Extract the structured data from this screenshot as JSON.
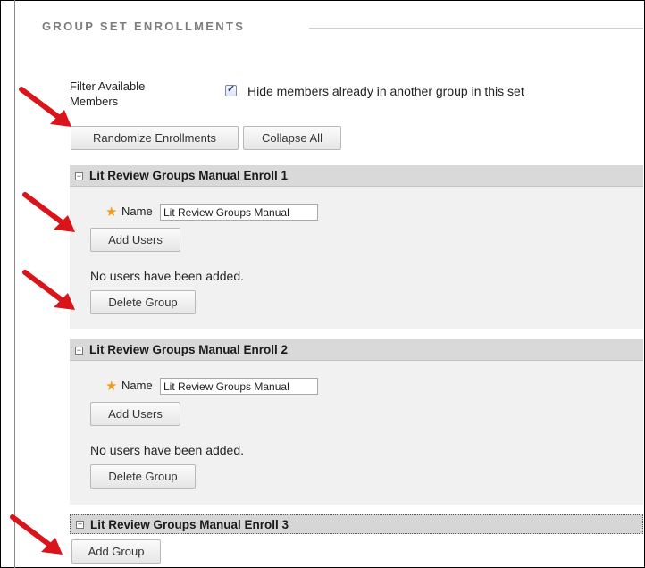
{
  "section_heading": "GROUP SET ENROLLMENTS",
  "filter": {
    "label": "Filter Available Members",
    "checkbox_checked": true,
    "checkbox_text": "Hide members already in another group in this set"
  },
  "toolbar": {
    "randomize_label": "Randomize Enrollments",
    "collapse_label": "Collapse All"
  },
  "groups": [
    {
      "title": "Lit Review Groups Manual Enroll 1",
      "expanded": true,
      "name_label": "Name",
      "name_value": "Lit Review Groups Manual",
      "add_users_label": "Add Users",
      "no_users_text": "No users have been added.",
      "delete_label": "Delete Group"
    },
    {
      "title": "Lit Review Groups Manual Enroll 2",
      "expanded": true,
      "name_label": "Name",
      "name_value": "Lit Review Groups Manual",
      "add_users_label": "Add Users",
      "no_users_text": "No users have been added.",
      "delete_label": "Delete Group"
    },
    {
      "title": "Lit Review Groups Manual Enroll 3",
      "expanded": false
    }
  ],
  "add_group_label": "Add Group",
  "colors": {
    "arrow": "#d9141b",
    "required_star": "#f39a1b",
    "panel_header": "#d9d9d9",
    "panel_body": "#f1f1f1"
  },
  "icons": {
    "required": "asterisk-icon",
    "collapse": "minus-square-icon",
    "expand": "plus-square-icon",
    "annotation": "red-arrow-icon"
  }
}
